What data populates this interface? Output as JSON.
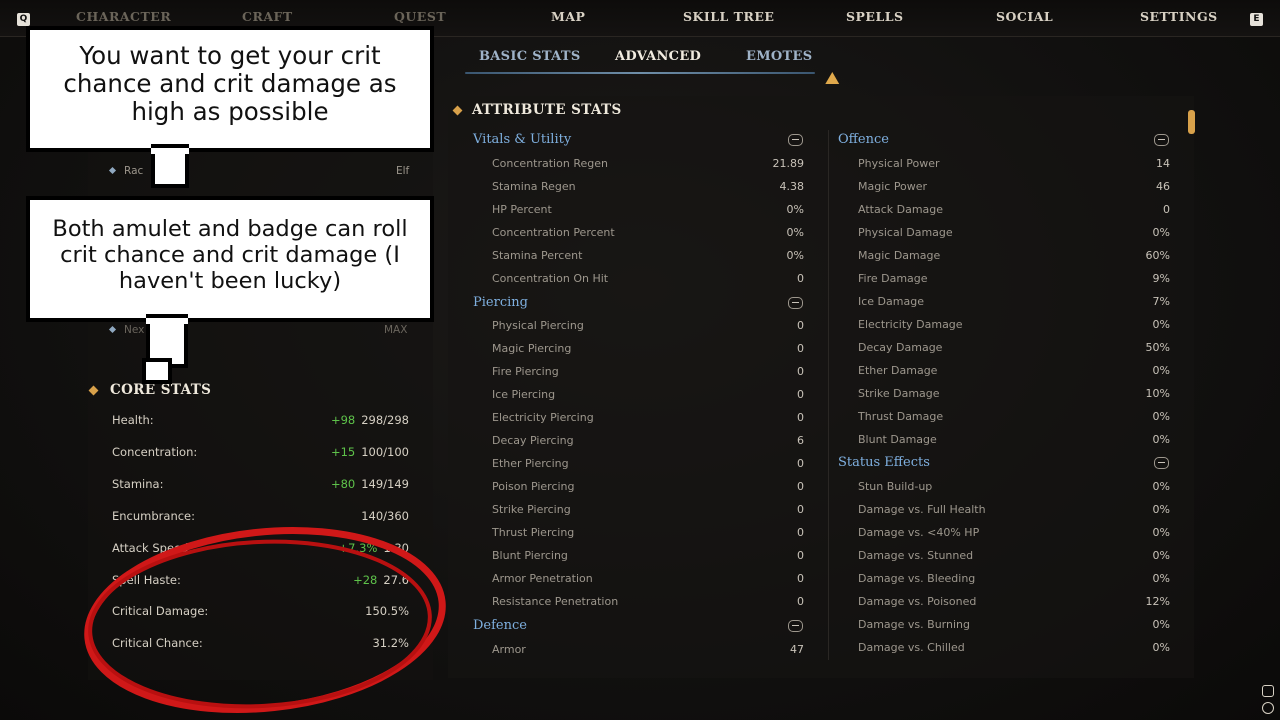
{
  "nav": {
    "left_key": "Q",
    "right_key": "E",
    "items": [
      "CHARACTER",
      "CRAFT",
      "QUEST",
      "MAP",
      "SKILL TREE",
      "SPELLS",
      "SOCIAL",
      "SETTINGS"
    ]
  },
  "tabs": [
    "BASIC STATS",
    "ADVANCED",
    "EMOTES"
  ],
  "left": {
    "race_label": "Rac",
    "race_value": "Elf",
    "next_label": "Nex",
    "next_value": "MAX",
    "core_title": "CORE STATS",
    "core_stats": [
      {
        "label": "Health:",
        "bonus": "+98",
        "value": "298/298"
      },
      {
        "label": "Concentration:",
        "bonus": "+15",
        "value": "100/100"
      },
      {
        "label": "Stamina:",
        "bonus": "+80",
        "value": "149/149"
      },
      {
        "label": "Encumbrance:",
        "bonus": "",
        "value": "140/360"
      },
      {
        "label": "Attack Speed:",
        "bonus": "+7.3%",
        "value": "1.30"
      },
      {
        "label": "Spell Haste:",
        "bonus": "+28",
        "value": "27.6"
      },
      {
        "label": "Critical Damage:",
        "bonus": "",
        "value": "150.5%"
      },
      {
        "label": "Critical Chance:",
        "bonus": "",
        "value": "31.2%"
      }
    ]
  },
  "attr_title": "ATTRIBUTE STATS",
  "groups": {
    "vitals": {
      "title": "Vitals & Utility",
      "rows": [
        {
          "label": "Concentration Regen",
          "value": "21.89"
        },
        {
          "label": "Stamina Regen",
          "value": "4.38"
        },
        {
          "label": "HP Percent",
          "value": "0%"
        },
        {
          "label": "Concentration Percent",
          "value": "0%"
        },
        {
          "label": "Stamina Percent",
          "value": "0%"
        },
        {
          "label": "Concentration On Hit",
          "value": "0"
        }
      ]
    },
    "piercing": {
      "title": "Piercing",
      "rows": [
        {
          "label": "Physical Piercing",
          "value": "0"
        },
        {
          "label": "Magic Piercing",
          "value": "0"
        },
        {
          "label": "Fire Piercing",
          "value": "0"
        },
        {
          "label": "Ice Piercing",
          "value": "0"
        },
        {
          "label": "Electricity Piercing",
          "value": "0"
        },
        {
          "label": "Decay Piercing",
          "value": "6"
        },
        {
          "label": "Ether Piercing",
          "value": "0"
        },
        {
          "label": "Poison Piercing",
          "value": "0"
        },
        {
          "label": "Strike Piercing",
          "value": "0"
        },
        {
          "label": "Thrust Piercing",
          "value": "0"
        },
        {
          "label": "Blunt Piercing",
          "value": "0"
        },
        {
          "label": "Armor Penetration",
          "value": "0"
        },
        {
          "label": "Resistance Penetration",
          "value": "0"
        }
      ]
    },
    "defence": {
      "title": "Defence",
      "rows": [
        {
          "label": "Armor",
          "value": "47"
        }
      ]
    },
    "offence": {
      "title": "Offence",
      "rows": [
        {
          "label": "Physical Power",
          "value": "14"
        },
        {
          "label": "Magic Power",
          "value": "46"
        },
        {
          "label": "Attack Damage",
          "value": "0"
        },
        {
          "label": "Physical Damage",
          "value": "0%"
        },
        {
          "label": "Magic Damage",
          "value": "60%"
        },
        {
          "label": "Fire Damage",
          "value": "9%"
        },
        {
          "label": "Ice Damage",
          "value": "7%"
        },
        {
          "label": "Electricity Damage",
          "value": "0%"
        },
        {
          "label": "Decay Damage",
          "value": "50%"
        },
        {
          "label": "Ether Damage",
          "value": "0%"
        },
        {
          "label": "Strike Damage",
          "value": "10%"
        },
        {
          "label": "Thrust Damage",
          "value": "0%"
        },
        {
          "label": "Blunt Damage",
          "value": "0%"
        }
      ]
    },
    "status": {
      "title": "Status Effects",
      "rows": [
        {
          "label": "Stun Build-up",
          "value": "0%"
        },
        {
          "label": "Damage vs. Full Health",
          "value": "0%"
        },
        {
          "label": "Damage vs. <40% HP",
          "value": "0%"
        },
        {
          "label": "Damage vs. Stunned",
          "value": "0%"
        },
        {
          "label": "Damage vs. Bleeding",
          "value": "0%"
        },
        {
          "label": "Damage vs. Poisoned",
          "value": "12%"
        },
        {
          "label": "Damage vs. Burning",
          "value": "0%"
        },
        {
          "label": "Damage vs. Chilled",
          "value": "0%"
        }
      ]
    }
  },
  "callouts": {
    "first": "You want to get your crit chance and crit damage as high as possible",
    "second": "Both amulet and badge can roll crit chance and crit damage (I haven't been lucky)"
  },
  "colors": {
    "accent_gold": "#d8a14a",
    "group_title_blue": "#7fb0e0",
    "bonus_green": "#5ec24a",
    "annotation_red": "#d01818"
  }
}
